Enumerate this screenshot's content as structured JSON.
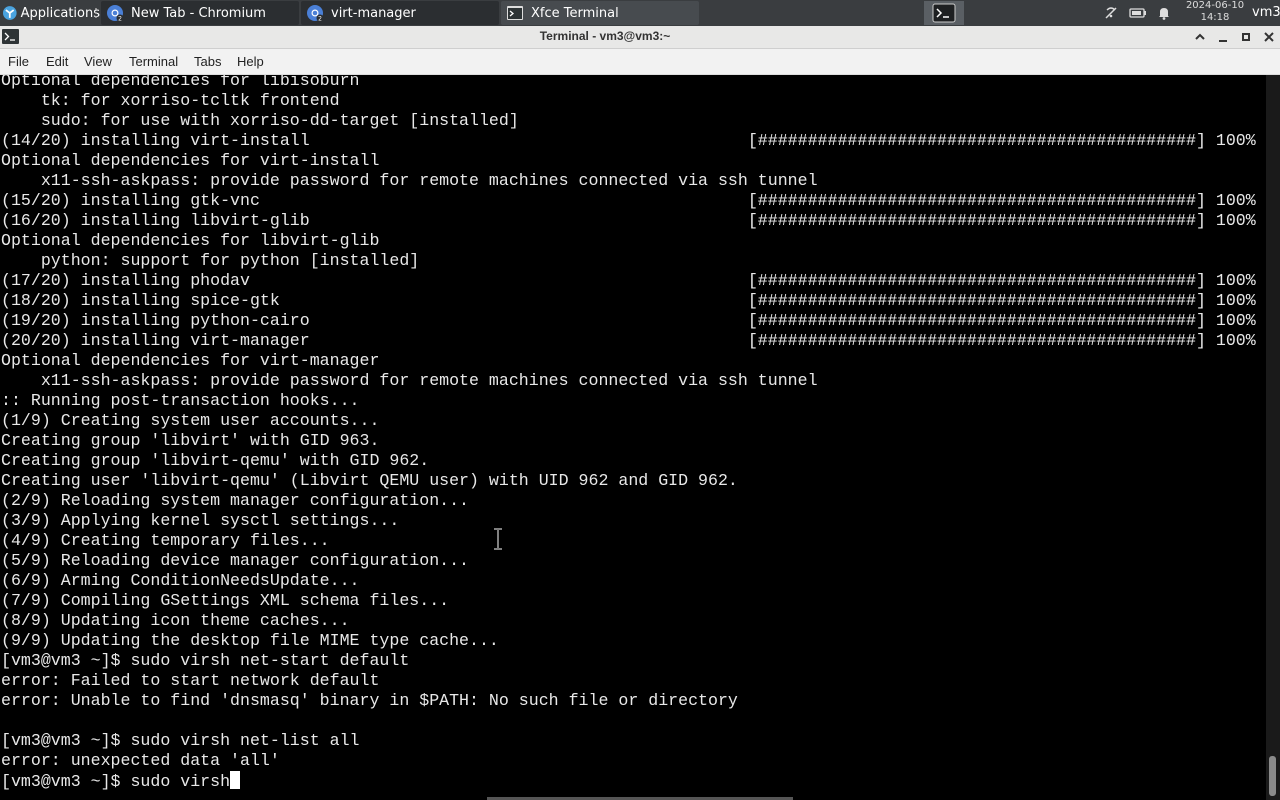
{
  "panel": {
    "applications_label": "Applications",
    "tasks": [
      {
        "label": "New Tab - Chromium",
        "icon": "chromium-icon",
        "active": false
      },
      {
        "label": "virt-manager",
        "icon": "chromium-icon",
        "active": false
      },
      {
        "label": "Xfce Terminal",
        "icon": "terminal-icon",
        "active": true
      }
    ],
    "clock_date": "2024-06-10",
    "clock_time": "14:18",
    "user": "vm3",
    "tray_icons": [
      "network-disconnected-icon",
      "battery-icon",
      "notification-bell-icon"
    ]
  },
  "window": {
    "title": "Terminal - vm3@vm3:~",
    "buttons": [
      "maximize-up",
      "minimize",
      "restore",
      "close"
    ]
  },
  "menubar": {
    "items": [
      "File",
      "Edit",
      "View",
      "Terminal",
      "Tabs",
      "Help"
    ]
  },
  "terminal": {
    "lines": [
      "Optional dependencies for libisoburn",
      "    tk: for xorriso-tcltk frontend",
      "    sudo: for use with xorriso-dd-target [installed]",
      "(14/20) installing virt-install                                            [############################################] 100%",
      "Optional dependencies for virt-install",
      "    x11-ssh-askpass: provide password for remote machines connected via ssh tunnel",
      "(15/20) installing gtk-vnc                                                 [############################################] 100%",
      "(16/20) installing libvirt-glib                                            [############################################] 100%",
      "Optional dependencies for libvirt-glib",
      "    python: support for python [installed]",
      "(17/20) installing phodav                                                  [############################################] 100%",
      "(18/20) installing spice-gtk                                               [############################################] 100%",
      "(19/20) installing python-cairo                                            [############################################] 100%",
      "(20/20) installing virt-manager                                            [############################################] 100%",
      "Optional dependencies for virt-manager",
      "    x11-ssh-askpass: provide password for remote machines connected via ssh tunnel",
      ":: Running post-transaction hooks...",
      "(1/9) Creating system user accounts...",
      "Creating group 'libvirt' with GID 963.",
      "Creating group 'libvirt-qemu' with GID 962.",
      "Creating user 'libvirt-qemu' (Libvirt QEMU user) with UID 962 and GID 962.",
      "(2/9) Reloading system manager configuration...",
      "(3/9) Applying kernel sysctl settings...",
      "(4/9) Creating temporary files...",
      "(5/9) Reloading device manager configuration...",
      "(6/9) Arming ConditionNeedsUpdate...",
      "(7/9) Compiling GSettings XML schema files...",
      "(8/9) Updating icon theme caches...",
      "(9/9) Updating the desktop file MIME type cache...",
      "[vm3@vm3 ~]$ sudo virsh net-start default",
      "error: Failed to start network default",
      "error: Unable to find 'dnsmasq' binary in $PATH: No such file or directory",
      "",
      "[vm3@vm3 ~]$ sudo virsh net-list all",
      "error: unexpected data 'all'",
      "[vm3@vm3 ~]$ sudo virsh"
    ]
  }
}
